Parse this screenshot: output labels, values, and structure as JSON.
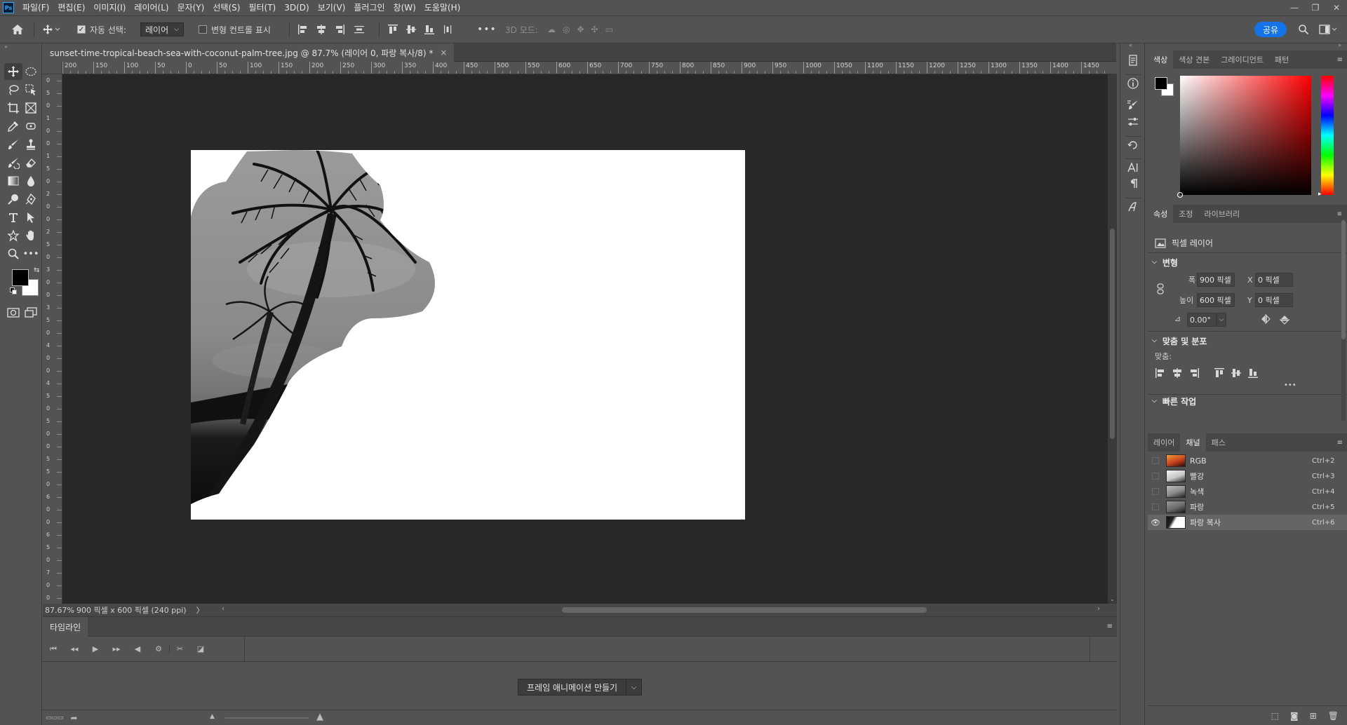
{
  "menu": {
    "items": [
      "파일(F)",
      "편집(E)",
      "이미지(I)",
      "레이어(L)",
      "문자(Y)",
      "선택(S)",
      "필터(T)",
      "3D(D)",
      "보기(V)",
      "플러그인",
      "창(W)",
      "도움말(H)"
    ],
    "app_badge": "Ps"
  },
  "options": {
    "auto_select_label": "자동 선택:",
    "auto_select_value": "레이어",
    "show_transform_label": "변형 컨트롤 표시",
    "mode_3d_label": "3D 모드:",
    "share_label": "공유"
  },
  "document": {
    "tab_title": "sunset-time-tropical-beach-sea-with-coconut-palm-tree.jpg @ 87.7% (레이어 0, 파랑 복사/8) *",
    "close": "×"
  },
  "ruler": {
    "top_labels": [
      "200",
      "150",
      "100",
      "50",
      "0",
      "50",
      "100",
      "150",
      "200",
      "250",
      "300",
      "350",
      "400",
      "450",
      "500",
      "550",
      "600",
      "650",
      "700",
      "750",
      "800",
      "850",
      "900",
      "950",
      "1000",
      "1050",
      "1100",
      "1150",
      "1200",
      "1250",
      "1300",
      "1350",
      "1400",
      "1450"
    ],
    "left_labels": [
      "0",
      "5",
      "0",
      "1",
      "0",
      "0",
      "1",
      "5",
      "0",
      "2",
      "0",
      "0",
      "2",
      "5",
      "0",
      "3",
      "0",
      "0",
      "3",
      "5",
      "0",
      "4",
      "0",
      "0",
      "4",
      "5",
      "0",
      "5",
      "0",
      "0",
      "5",
      "5",
      "0",
      "6",
      "0",
      "0",
      "6",
      "5",
      "0",
      "7",
      "0",
      "0"
    ]
  },
  "status": {
    "zoom": "87.67%",
    "doc_info": "900 픽셀 x 600 픽셀 (240 ppi)",
    "arrow": "〉"
  },
  "timeline": {
    "tab_label": "타임라인",
    "create_button": "프레임 애니메이션 만들기"
  },
  "color_panel": {
    "tabs": [
      "색상",
      "색상 견본",
      "그레이디언트",
      "패턴"
    ],
    "foreground": "#000000",
    "background": "#ffffff"
  },
  "properties": {
    "tabs": [
      "속성",
      "조정",
      "라이브러리"
    ],
    "layer_type": "픽셀 레이어",
    "transform_title": "변형",
    "width_label": "폭",
    "width_value": "900 픽셀",
    "height_label": "높이",
    "height_value": "600 픽셀",
    "x_label": "X",
    "x_value": "0 픽셀",
    "y_label": "Y",
    "y_value": "0 픽셀",
    "angle_value": "0.00°",
    "align_title": "맞춤 및 분포",
    "align_label": "맞춤:",
    "more": "•••",
    "quick_title": "빠른 작업"
  },
  "channels_panel": {
    "tabs": [
      "레이어",
      "채널",
      "패스"
    ],
    "rows": [
      {
        "name": "RGB",
        "shortcut": "Ctrl+2"
      },
      {
        "name": "빨강",
        "shortcut": "Ctrl+3"
      },
      {
        "name": "녹색",
        "shortcut": "Ctrl+4"
      },
      {
        "name": "파랑",
        "shortcut": "Ctrl+5"
      },
      {
        "name": "파랑 복사",
        "shortcut": "Ctrl+6"
      }
    ]
  }
}
